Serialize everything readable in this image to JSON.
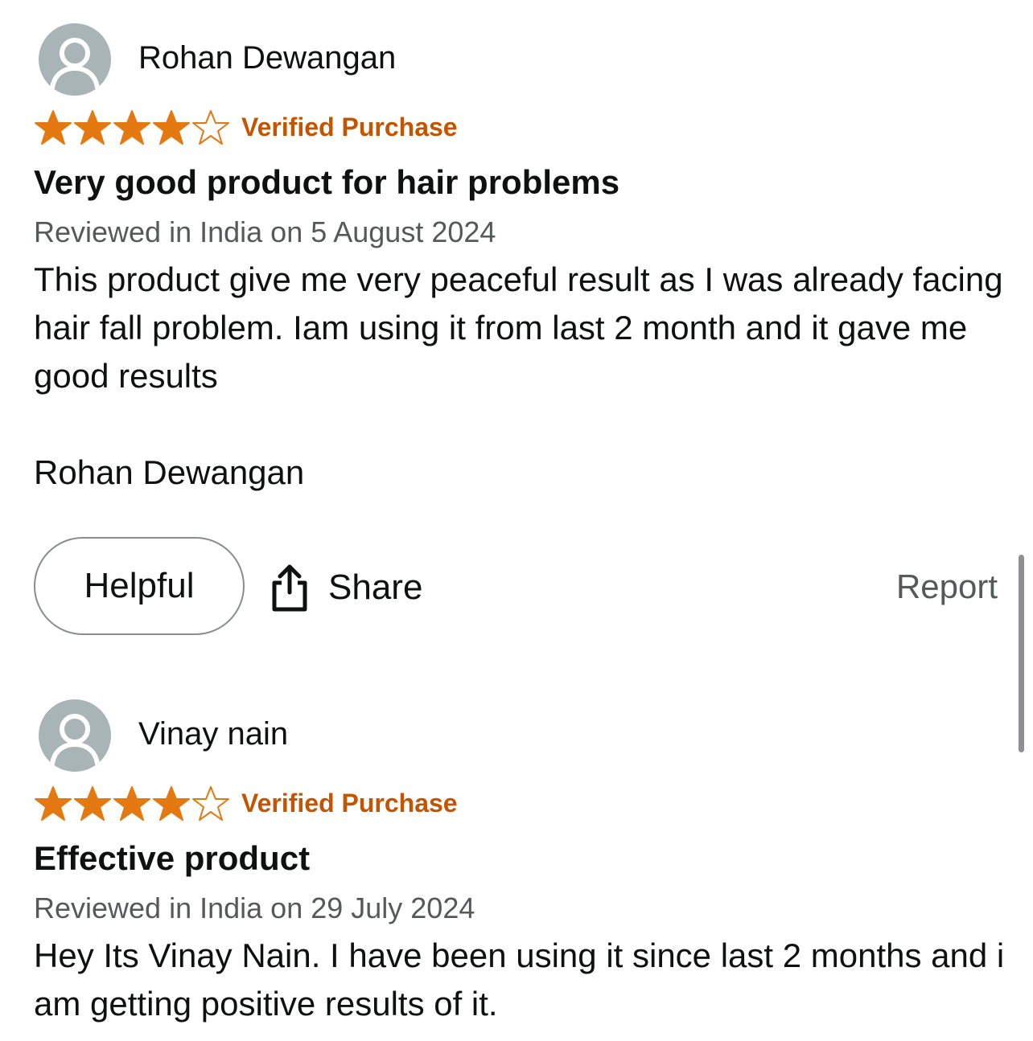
{
  "colors": {
    "star_fill": "#e47911",
    "verified": "#c45500",
    "meta": "#565959",
    "avatar_bg": "#a9b4b6"
  },
  "reviews": [
    {
      "author": "Rohan Dewangan",
      "rating": 4,
      "rating_max": 5,
      "badge": "Verified Purchase",
      "title": "Very good product for hair problems",
      "meta": "Reviewed in India on 5 August 2024",
      "body": "This product give me very peaceful result as I was already facing hair fall problem. Iam using it from last 2 month and it gave me good results\n\nRohan Dewangan",
      "actions": {
        "helpful_label": "Helpful",
        "share_label": "Share",
        "report_label": "Report"
      }
    },
    {
      "author": "Vinay nain",
      "rating": 4,
      "rating_max": 5,
      "badge": "Verified Purchase",
      "title": "Effective product",
      "meta": "Reviewed in India on 29 July 2024",
      "body": "Hey Its Vinay Nain. I have been using it since last 2 months and i am getting positive results of it."
    }
  ]
}
